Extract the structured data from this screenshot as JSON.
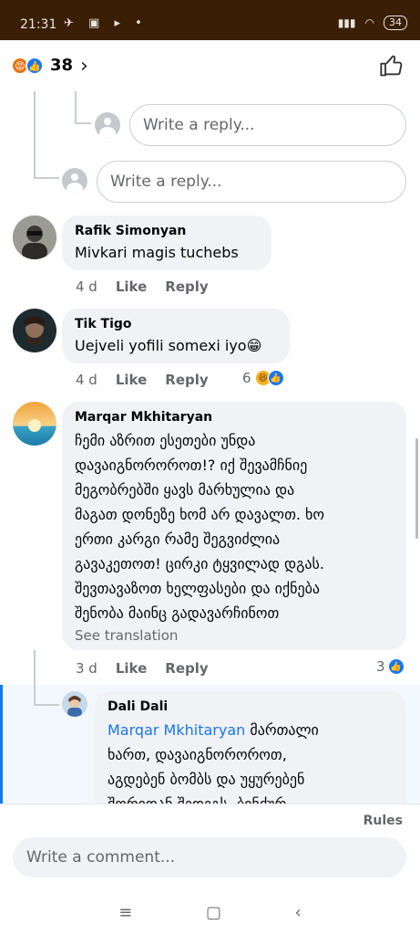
{
  "status_bar": {
    "time": "21:31",
    "battery": "34"
  },
  "reactions": {
    "count": "38",
    "icons": [
      "angry-icon",
      "like-icon"
    ]
  },
  "reply_boxes": [
    {
      "placeholder": "Write a reply..."
    },
    {
      "placeholder": "Write a reply..."
    }
  ],
  "comments": [
    {
      "author": "Rafik Simonyan",
      "text": "Mivkari  magis  tuchebs",
      "time": "4 d",
      "like": "Like",
      "reply": "Reply"
    },
    {
      "author": "Tik Tigo",
      "text": "Uejveli yofili somexi iyo",
      "emoji": "😁",
      "time": "4 d",
      "like": "Like",
      "reply": "Reply",
      "reaction_count": "6"
    },
    {
      "author": "Marqar Mkhitaryan",
      "lines": [
        "ჩემი აზრით ესეთები უნდა",
        "დავაიგნოროროთ!? იქ შევამჩნიე",
        "მეგობრებში ყავს მარხულია და",
        "მაგათ დონეზე ხომ არ დავალთ. ხო",
        "ერთი კარგი რამე შეგვიძლია",
        "გავაკეთოთ! ცირკი ტყვილად დგას.",
        "შევთავაზოთ ხელფასები და იქნება",
        "შენობა მაინც გადავარჩინოთ"
      ],
      "see_translation": "See translation",
      "time": "3 d",
      "like": "Like",
      "reply": "Reply",
      "reaction_count": "3"
    },
    {
      "author": "Dali Dali",
      "mention": "Marqar Mkhitaryan",
      "lines": [
        "მართალი",
        "ხართ, დავაიგნოროროთ,",
        "აგდებენ ბომბს და უყურებენ",
        "შორიდან შედეგს. ბინძურ"
      ]
    }
  ],
  "bottom": {
    "rules": "Rules",
    "comment_placeholder": "Write a comment..."
  },
  "nav": [
    "≡",
    "▢",
    "‹"
  ]
}
